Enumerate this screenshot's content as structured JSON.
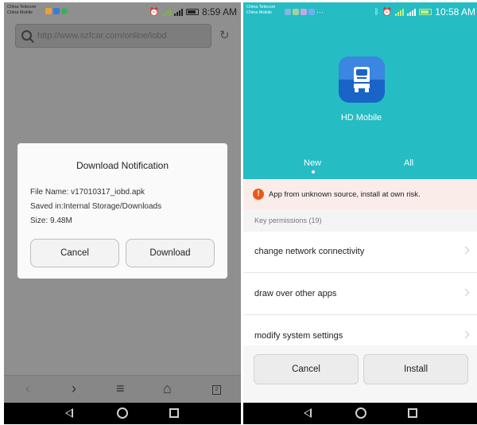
{
  "left": {
    "status": {
      "carrier1": "China Telecom",
      "carrier2": "China Mobile",
      "time": "8:59 AM"
    },
    "url": "http://www.szfcar.com/online/iobd",
    "dialog": {
      "title": "Download Notification",
      "file_name": "File Name: v17010317_iobd.apk",
      "saved_in": "Saved in:Internal Storage/Downloads",
      "size": "Size: 9.48M",
      "cancel": "Cancel",
      "download": "Download"
    },
    "toolbar": {
      "back_glyph": "‹",
      "forward_glyph": "›",
      "menu_glyph": "≡",
      "home_glyph": "⌂",
      "tab_count": "2"
    }
  },
  "right": {
    "status": {
      "carrier1": "China Telecom",
      "carrier2": "China Mobile",
      "time": "10:58 AM"
    },
    "app_name": "HD Mobile",
    "tabs": [
      "New",
      "All"
    ],
    "warning": "App from unknown source, install at own risk.",
    "permissions_header": "Key permissions (19)",
    "permissions": [
      "change network connectivity",
      "draw over other apps",
      "modify system settings"
    ],
    "buttons": {
      "cancel": "Cancel",
      "install": "Install"
    }
  },
  "colors": {
    "teal": "#25bcc4",
    "warning": "#e85a18",
    "app_icon": "#1a64c8"
  }
}
